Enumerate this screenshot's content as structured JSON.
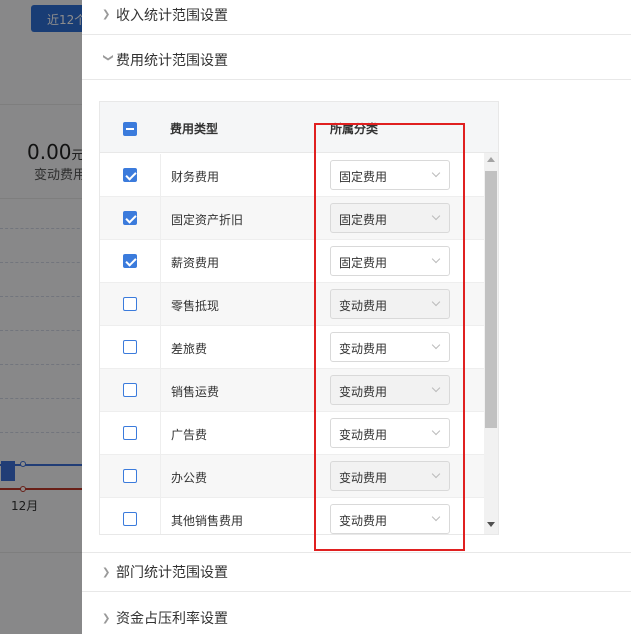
{
  "background": {
    "button_label": "近12个",
    "stat_value": "0.00",
    "stat_unit": "元",
    "stat_label": "变动费用",
    "x_label": "12月"
  },
  "sections": {
    "income": "收入统计范围设置",
    "expense": "费用统计范围设置",
    "department": "部门统计范围设置",
    "capital": "资金占压利率设置"
  },
  "table": {
    "col_type": "费用类型",
    "col_category": "所属分类",
    "rows": [
      {
        "name": "财务费用",
        "checked": true,
        "category": "固定费用",
        "disabled": false
      },
      {
        "name": "固定资产折旧",
        "checked": true,
        "category": "固定费用",
        "disabled": true
      },
      {
        "name": "薪资费用",
        "checked": true,
        "category": "固定费用",
        "disabled": false
      },
      {
        "name": "零售抵现",
        "checked": false,
        "category": "变动费用",
        "disabled": true
      },
      {
        "name": "差旅费",
        "checked": false,
        "category": "变动费用",
        "disabled": false
      },
      {
        "name": "销售运费",
        "checked": false,
        "category": "变动费用",
        "disabled": true
      },
      {
        "name": "广告费",
        "checked": false,
        "category": "变动费用",
        "disabled": false
      },
      {
        "name": "办公费",
        "checked": false,
        "category": "变动费用",
        "disabled": true
      },
      {
        "name": "其他销售费用",
        "checked": false,
        "category": "变动费用",
        "disabled": false
      }
    ]
  },
  "colors": {
    "accent": "#3b7bdc",
    "annotation": "#e02020",
    "mask": "rgba(0,0,0,0.45)"
  },
  "icons": {
    "collapsed": "chevron-right-icon",
    "expanded": "chevron-down-icon",
    "select": "chevron-down-icon"
  }
}
